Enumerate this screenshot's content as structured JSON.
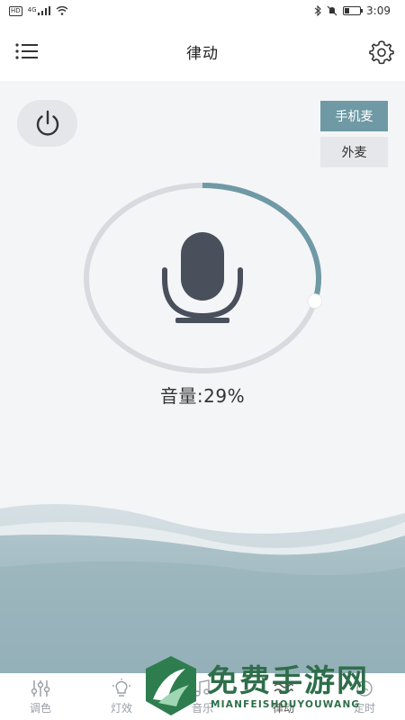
{
  "status_bar": {
    "time": "3:09",
    "network_badge": "HD",
    "signal_label": "4G"
  },
  "header": {
    "title": "律动"
  },
  "mic_sources": {
    "phone_label": "手机麦",
    "external_label": "外麦",
    "selected": "phone"
  },
  "volume": {
    "label": "音量:29%",
    "percent": 29
  },
  "nav": {
    "items": [
      {
        "label": "调色",
        "icon": "sliders-icon"
      },
      {
        "label": "灯效",
        "icon": "bulb-icon"
      },
      {
        "label": "音乐",
        "icon": "music-icon"
      },
      {
        "label": "律动",
        "icon": "wave-icon"
      },
      {
        "label": "定时",
        "icon": "clock-icon"
      }
    ],
    "active_index": 3
  },
  "watermark": {
    "title": "免费手游网",
    "subtitle": "MIANFEISHOUYOUWANG"
  },
  "colors": {
    "accent": "#6f9aa5",
    "track": "#d8dadf",
    "mic": "#4a4f5c"
  }
}
